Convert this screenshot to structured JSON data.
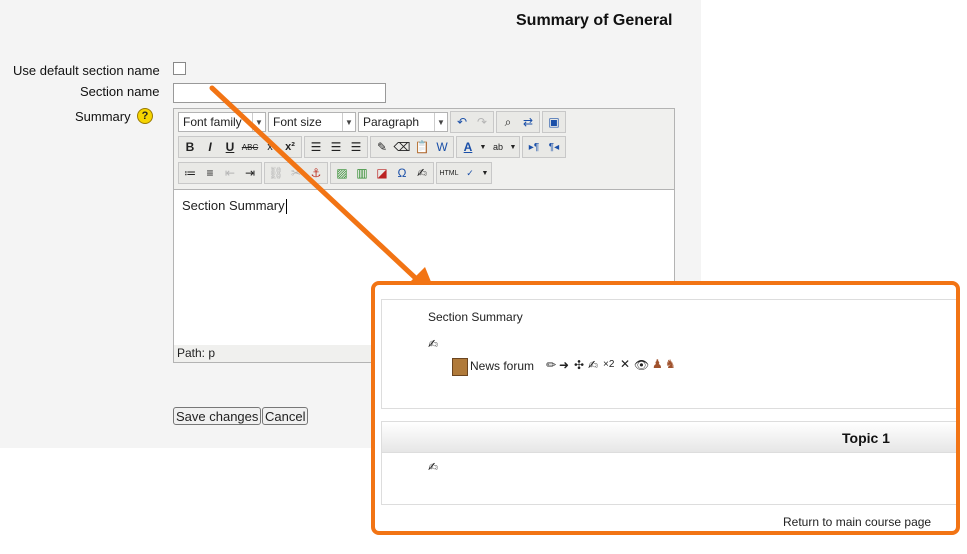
{
  "page_title": "Summary of General",
  "form": {
    "use_default_label": "Use default section name",
    "section_name_label": "Section name",
    "summary_label": "Summary",
    "help_icon": "?"
  },
  "editor": {
    "font_family": "Font family",
    "font_size": "Font size",
    "format": "Paragraph",
    "content": "Section Summary",
    "path": "Path: p",
    "buttons": {
      "bold": "B",
      "italic": "I",
      "underline": "U",
      "strike": "ABC",
      "sub": "x",
      "sup": "x²",
      "omega": "Ω",
      "html": "HTML"
    }
  },
  "buttons": {
    "save": "Save changes",
    "cancel": "Cancel"
  },
  "preview": {
    "summary_text": "Section Summary",
    "forum_link": "News forum",
    "group_mode": "×2",
    "topic_title": "Topic 1",
    "return_link": "Return to main course page"
  },
  "colors": {
    "callout_border": "#f27414",
    "link": "#1437c4"
  }
}
